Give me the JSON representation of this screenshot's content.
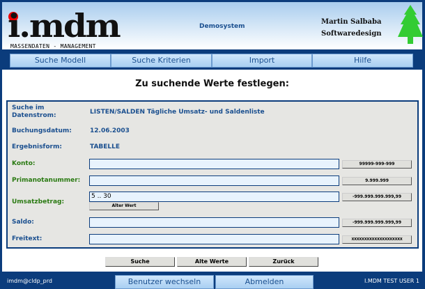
{
  "header": {
    "logo": "i.mdm",
    "logo_sub": "MASSENDATEN - MANAGEMENT",
    "system": "Demosystem",
    "author_line1": "Martin Salbaba",
    "author_line2": "Softwaredesign"
  },
  "nav": [
    "Suche Modell",
    "Suche Kriterien",
    "Import",
    "Hilfe"
  ],
  "main": {
    "title": "Zu suchende Werte festlegen:",
    "info": [
      {
        "label": "Suche im Datenstrom:",
        "value": "LISTEN/SALDEN Tägliche Umsatz- und Saldenliste"
      },
      {
        "label": "Buchungsdatum:",
        "value": "12.06.2003"
      },
      {
        "label": "Ergebnisform:",
        "value": "TABELLE"
      }
    ],
    "fields": [
      {
        "label": "Konto:",
        "value": "",
        "format": "99999-999-999"
      },
      {
        "label": "Primanotanummer:",
        "value": "",
        "format": "9.999.999"
      },
      {
        "label": "Umsatzbetrag:",
        "value": "5 .. 30",
        "format": "-999.999.999.999,99",
        "old_value_button": "Alter Wert"
      },
      {
        "label": "Saldo:",
        "value": "",
        "format": "-999.999.999.999,99"
      },
      {
        "label": "Freitext:",
        "value": "",
        "format": "XXXXXXXXXXXXXXXXXXXX"
      }
    ],
    "buttons": [
      "Suche",
      "Alte Werte",
      "Zurück"
    ]
  },
  "footer": {
    "connection": "imdm@cldp_prd",
    "switch_user": "Benutzer wechseln",
    "logout": "Abmelden",
    "user": "I.MDM TEST USER 1"
  }
}
